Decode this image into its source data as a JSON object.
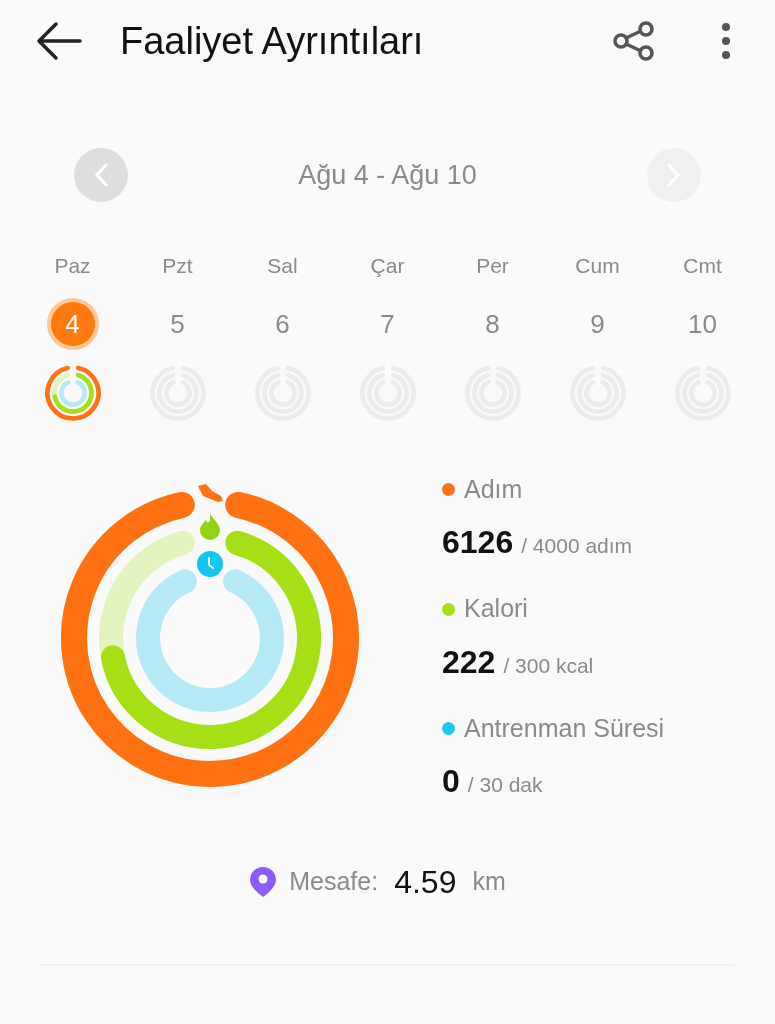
{
  "header": {
    "title": "Faaliyet Ayrıntıları"
  },
  "week_nav": {
    "range": "Ağu 4 - Ağu 10",
    "prev_disabled": false,
    "next_disabled": true
  },
  "days": [
    {
      "weekday": "Paz",
      "date": "4",
      "selected": true,
      "has_activity": true
    },
    {
      "weekday": "Pzt",
      "date": "5",
      "selected": false,
      "has_activity": false
    },
    {
      "weekday": "Sal",
      "date": "6",
      "selected": false,
      "has_activity": false
    },
    {
      "weekday": "Çar",
      "date": "7",
      "selected": false,
      "has_activity": false
    },
    {
      "weekday": "Per",
      "date": "8",
      "selected": false,
      "has_activity": false
    },
    {
      "weekday": "Cum",
      "date": "9",
      "selected": false,
      "has_activity": false
    },
    {
      "weekday": "Cmt",
      "date": "10",
      "selected": false,
      "has_activity": false
    }
  ],
  "metrics": [
    {
      "kind": "steps",
      "label": "Adım",
      "value": "6126",
      "goal": "/ 4000 adım",
      "color": "#ff7214"
    },
    {
      "kind": "calories",
      "label": "Kalori",
      "value": "222",
      "goal": "/ 300 kcal",
      "color": "#a6df16"
    },
    {
      "kind": "workout",
      "label": "Antrenman Süresi",
      "value": "0",
      "goal": "/ 30 dak",
      "color": "#1ec8ef"
    }
  ],
  "distance": {
    "label": "Mesafe:",
    "value": "4.59",
    "unit": "km"
  }
}
